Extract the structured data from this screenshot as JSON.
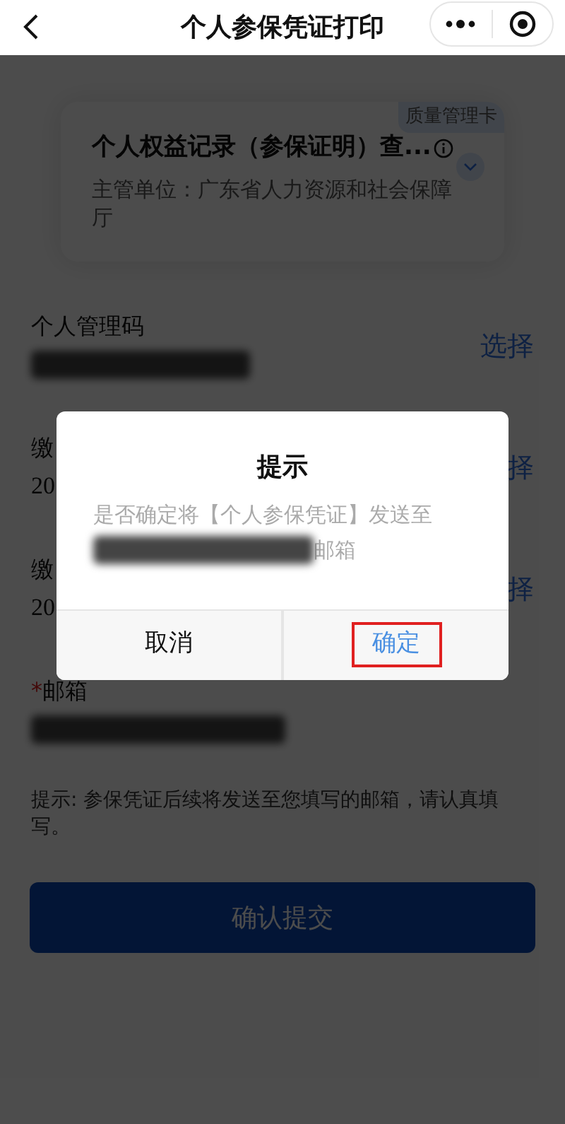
{
  "header": {
    "title": "个人参保凭证打印"
  },
  "service_card": {
    "tag": "质量管理卡",
    "title": "个人权益记录（参保证明）查...",
    "expanded": false,
    "subtitle": "主管单位：广东省人力资源和社会保障厅"
  },
  "fields": [
    {
      "label": "个人管理码",
      "value_redacted": true,
      "action": "选择"
    },
    {
      "label": "缴",
      "value": "20",
      "value_redacted": false,
      "action": "择"
    },
    {
      "label": "缴",
      "value": "20",
      "value_redacted": false,
      "action": "择"
    },
    {
      "required_mark": "*",
      "label": "邮箱",
      "value_redacted": true
    }
  ],
  "hint": "提示: 参保凭证后续将发送至您填写的邮箱，请认真填写。",
  "submit_button": {
    "label": "确认提交"
  },
  "dialog": {
    "title": "提示",
    "message_before": "是否确定将【个人参保凭证】发送至",
    "message_after": "邮箱",
    "buttons": [
      {
        "label": "取消",
        "kind": "cancel",
        "highlighted": false
      },
      {
        "label": "确定",
        "kind": "confirm",
        "highlighted": true
      }
    ]
  }
}
